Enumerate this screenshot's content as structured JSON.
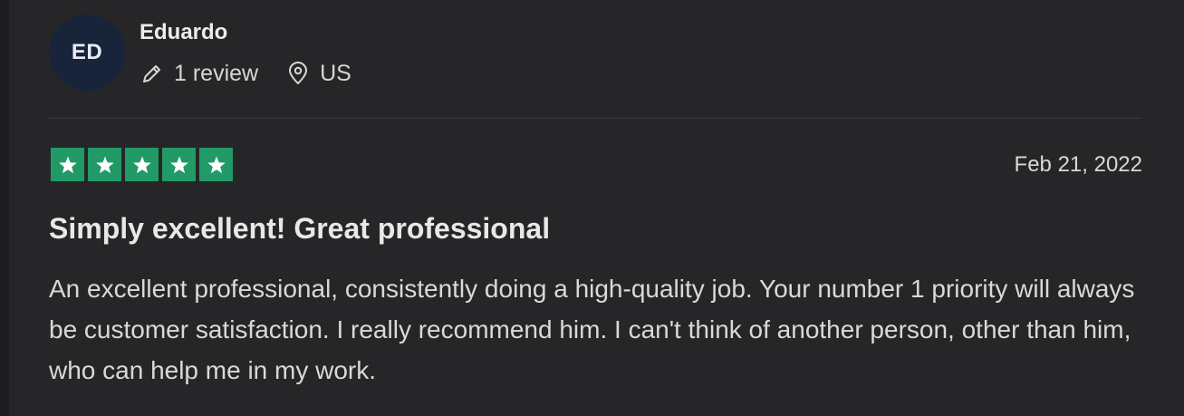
{
  "reviewer": {
    "initials": "ED",
    "name": "Eduardo",
    "review_count": "1 review",
    "country": "US"
  },
  "review": {
    "rating": 5,
    "rating_max": 5,
    "date": "Feb 21, 2022",
    "title": "Simply excellent! Great professional",
    "body": "An excellent professional, consistently doing a high-quality job. Your number 1 priority will always be customer satisfaction. I really recommend him. I can't think of another person, other than him, who can help me in my work."
  },
  "icons": {
    "review_count": "pencil-icon",
    "country": "location-pin-icon",
    "rating": "star-icon"
  },
  "colors": {
    "background": "#262628",
    "avatar": "#17243a",
    "star": "#219a67"
  }
}
